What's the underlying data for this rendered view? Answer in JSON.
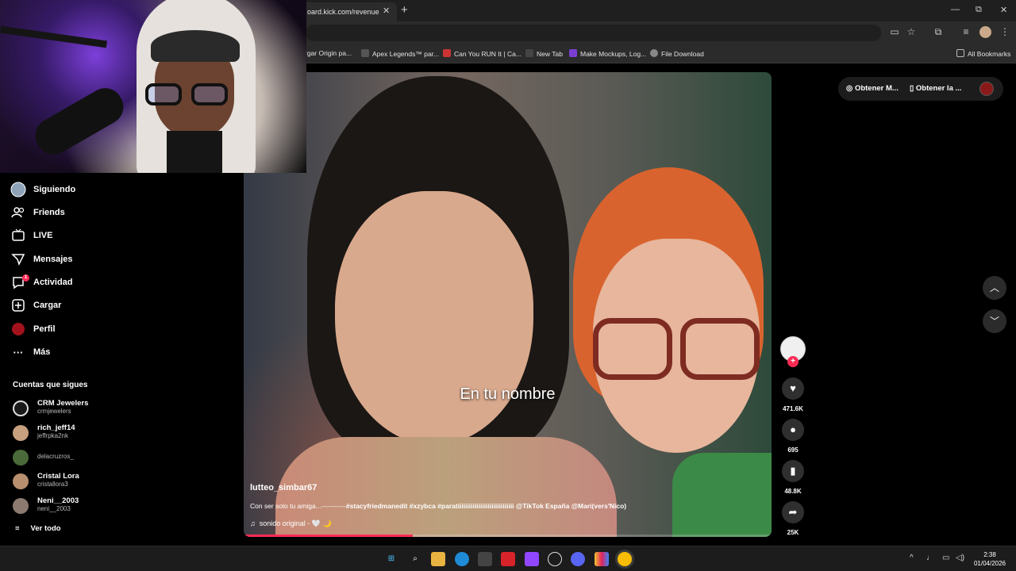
{
  "browser": {
    "tab_title": "oard.kick.com/revenue",
    "tab_close": "✕",
    "new_tab": "+",
    "window": {
      "minimize": "—",
      "maximize": "⧉",
      "close": "✕"
    },
    "bookmarks": [
      "rgar Origin pa...",
      "Apex Legends™ par...",
      "Can You RUN It | Ca...",
      "New Tab",
      "Make Mockups, Log...",
      "File Download"
    ],
    "all_bookmarks": "All Bookmarks"
  },
  "sidebar": {
    "items": [
      {
        "label": "Siguiendo",
        "icon": "following-avatar-icon"
      },
      {
        "label": "Friends",
        "icon": "friends-icon"
      },
      {
        "label": "LIVE",
        "icon": "live-icon"
      },
      {
        "label": "Mensajes",
        "icon": "messages-icon"
      },
      {
        "label": "Actividad",
        "icon": "activity-icon",
        "badge": "1"
      },
      {
        "label": "Cargar",
        "icon": "upload-icon"
      },
      {
        "label": "Perfil",
        "icon": "profile-icon"
      },
      {
        "label": "Más",
        "icon": "more-icon"
      }
    ],
    "following_title": "Cuentas que sigues",
    "accounts": [
      {
        "name": "CRM Jewelers",
        "handle": "crmjewelers"
      },
      {
        "name": "rich_jeff14",
        "handle": "jeffrpka2nk"
      },
      {
        "name": "",
        "handle": "delacruzros_"
      },
      {
        "name": "Cristal Lora",
        "handle": "cristallora3"
      },
      {
        "name": "Neni__2003",
        "handle": "neni__2003"
      }
    ],
    "see_all": "Ver todo"
  },
  "video": {
    "subtitle": "En tu nombre",
    "username": "lutteo_simbar67",
    "description_plain": "Con ser solo tu amiga...-----------",
    "description_tags": "#stacyfriedmanedit #xzybca #paratiiiiiiiiiiiiiiiiiiiiiiiiiiiiii @TikTok España @Mari(vers'Nico)",
    "music": "sonido original - 🤍 🌙",
    "progress": 0.32
  },
  "actions": {
    "likes": "471.6K",
    "comments": "695",
    "saves": "48.8K",
    "shares": "25K"
  },
  "top_bar": {
    "get_coins": "Obtener M...",
    "get_app": "Obtener la ..."
  },
  "taskbar": {
    "time": "2:38",
    "date": "01/04/2026"
  },
  "colors": {
    "accent": "#fe2c55",
    "background": "#000000"
  }
}
